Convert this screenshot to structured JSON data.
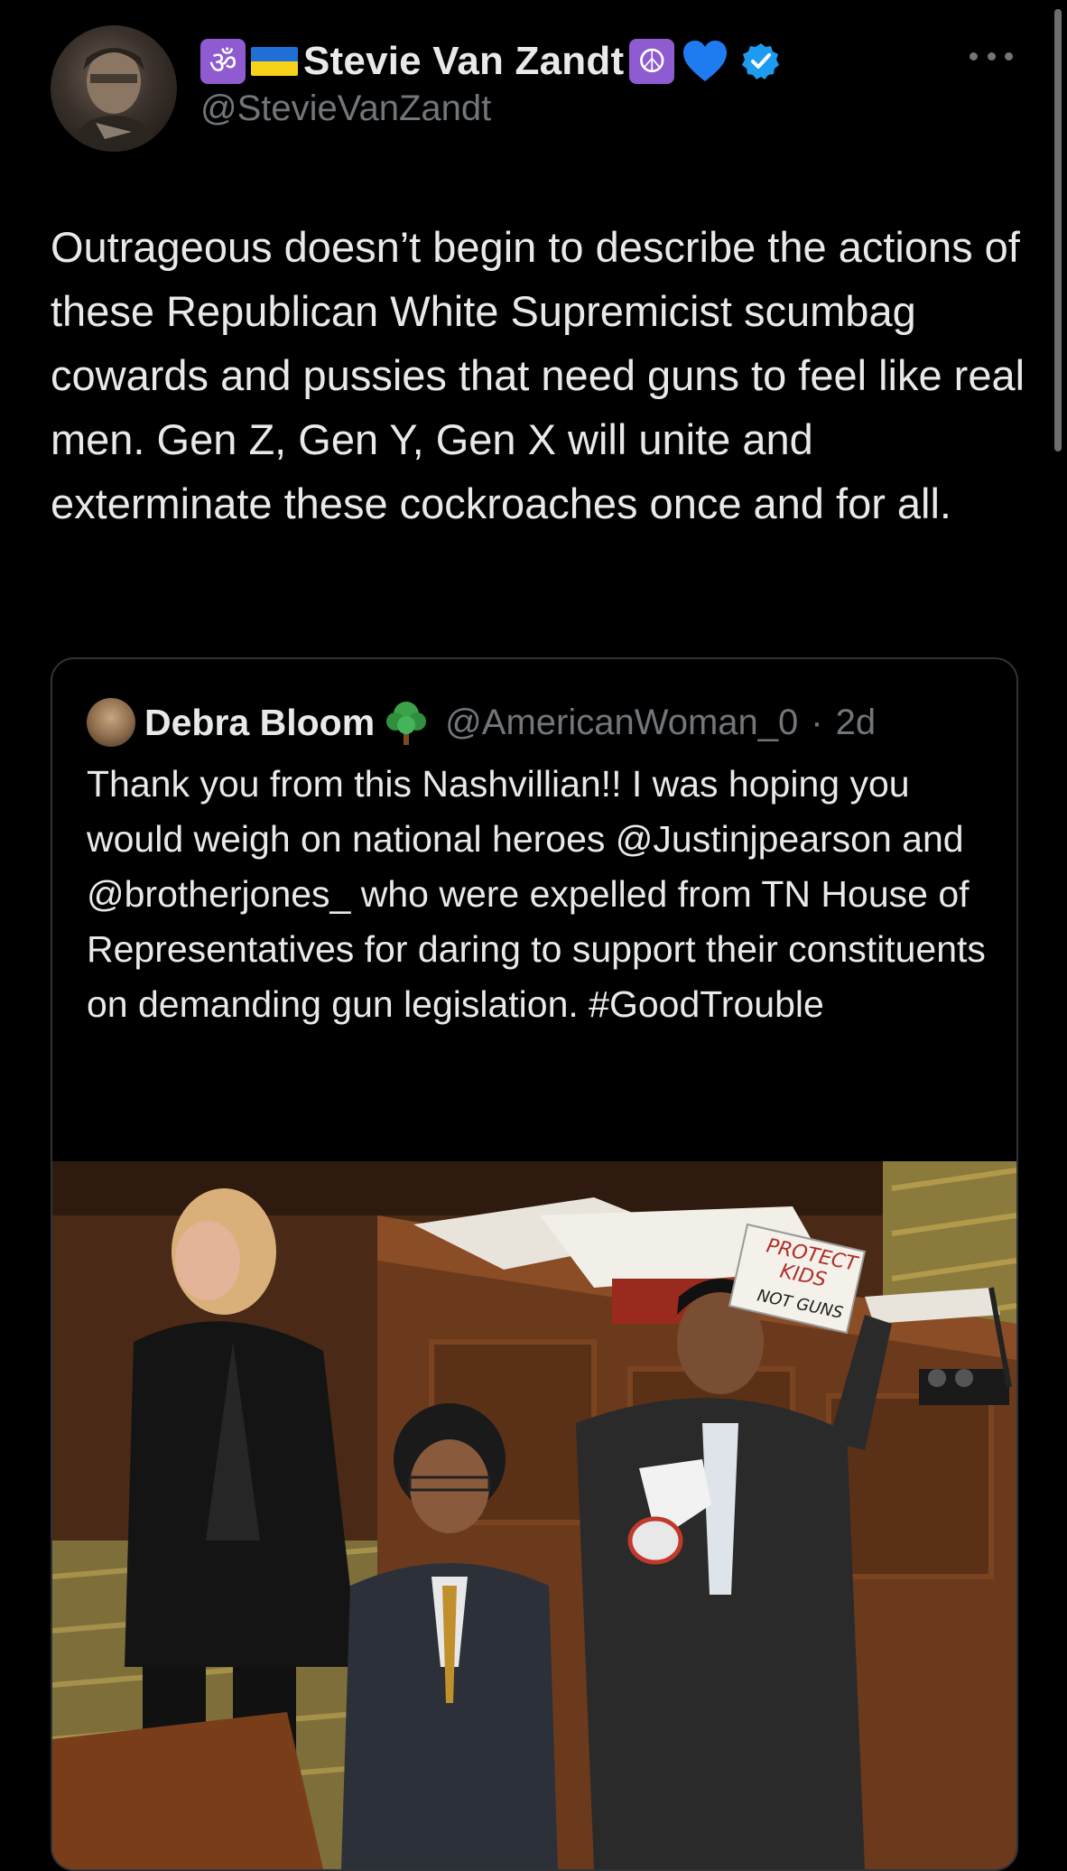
{
  "tweet": {
    "author": {
      "display_name": "Stevie Van Zandt",
      "handle": "@StevieVanZandt",
      "badges": [
        "om-icon",
        "ukraine-flag-icon",
        "peace-icon",
        "blue-heart-icon",
        "verified-icon"
      ]
    },
    "text": "Outrageous doesn’t begin to describe the actions of these Republican White Supremicist scumbag cowards and pussies that need guns to feel like real men. Gen Z, Gen Y, Gen X will unite and exterminate these cockroaches once and for all.",
    "more_icon": "more-horizontal-icon"
  },
  "quoted": {
    "author": {
      "display_name": "Debra Bloom",
      "handle": "@AmericanWoman_0",
      "emoji": "tree-icon"
    },
    "separator": "·",
    "time": "2d",
    "text": "Thank you from this Nashvillian!! I was hoping you would weigh on national heroes @Justinjpearson and @brotherjones_  who were expelled from TN House of Representatives for daring to support their constituents on demanding gun legislation. #GoodTrouble",
    "photo": {
      "sign_lines": [
        "PROTECT",
        "KIDS",
        "NOT GUNS"
      ]
    }
  },
  "colors": {
    "background": "#000000",
    "text": "#e7e9ea",
    "secondary": "#71767b",
    "verified": "#1d9bf0",
    "border": "#2f3336"
  }
}
